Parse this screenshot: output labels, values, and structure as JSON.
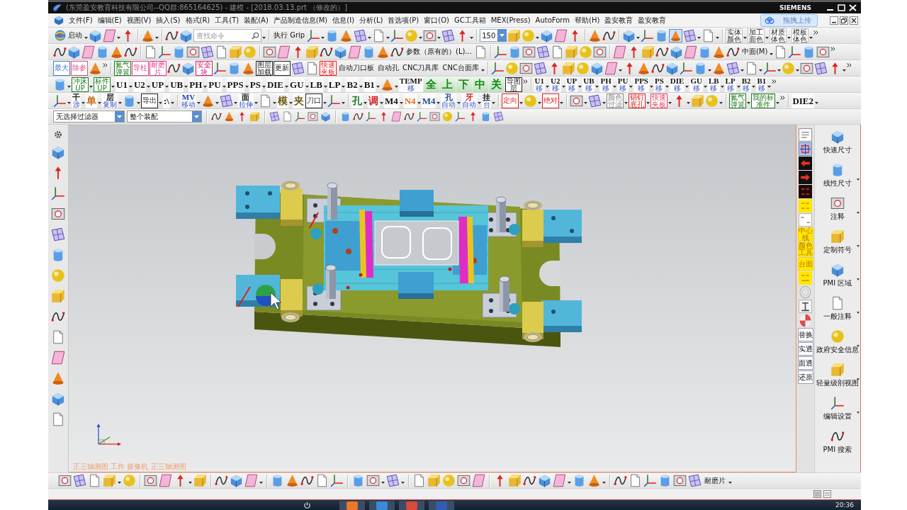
{
  "window": {
    "title": "(东莞盈安教育科技有限公司--QQ群:865164625) - 建模 - [2018.03.13.prt （修改的）]",
    "brand": "SIEMENS"
  },
  "menu": [
    "文件(F)",
    "编辑(E)",
    "视图(V)",
    "插入(S)",
    "格式(R)",
    "工具(T)",
    "装配(A)",
    "产品制造信息(M)",
    "信息(I)",
    "分析(L)",
    "首选项(P)",
    "窗口(O)",
    "GC工具箱",
    "MEX(Press)",
    "AutoForm",
    "帮助(H)",
    "盈安教育",
    "盈安教育"
  ],
  "upload_button": {
    "label": "拖拽上传"
  },
  "toolbars": [
    {
      "items": [
        {
          "kind": "start",
          "text": "启动",
          "menu": true
        },
        {
          "kind": "icon",
          "pressed": false
        },
        {
          "kind": "icon",
          "pressed": false,
          "menu": true
        },
        {
          "kind": "icon",
          "pressed": false
        },
        {
          "kind": "sep"
        },
        {
          "kind": "icon",
          "pressed": false,
          "menu": true
        },
        {
          "kind": "sep"
        },
        {
          "kind": "icon",
          "pressed": false
        },
        {
          "kind": "icon",
          "pressed": false
        },
        {
          "kind": "search",
          "placeholder": "查找命令",
          "menu": true
        },
        {
          "kind": "sep"
        },
        {
          "kind": "label",
          "text": "执行 Grip"
        },
        {
          "kind": "icon",
          "pressed": false,
          "menu": true
        },
        {
          "kind": "icon",
          "pressed": false
        },
        {
          "kind": "icon",
          "pressed": false
        },
        {
          "kind": "icon",
          "pressed": false,
          "menu": true
        },
        {
          "kind": "icon",
          "pressed": false,
          "menu": true
        },
        {
          "kind": "icon",
          "pressed": false
        },
        {
          "kind": "icon",
          "pressed": false,
          "menu": true
        },
        {
          "kind": "icon",
          "pressed": false,
          "menu": true
        },
        {
          "kind": "icon",
          "pressed": false
        },
        {
          "kind": "icon",
          "pressed": false,
          "menu": true
        },
        {
          "kind": "sep"
        },
        {
          "kind": "combo",
          "value": "150"
        },
        {
          "kind": "icon",
          "pressed": false
        },
        {
          "kind": "icon",
          "pressed": false,
          "menu": true
        },
        {
          "kind": "icon",
          "pressed": false
        },
        {
          "kind": "icon",
          "pressed": false
        },
        {
          "kind": "icon",
          "pressed": false
        },
        {
          "kind": "sep"
        },
        {
          "kind": "icon",
          "pressed": false
        },
        {
          "kind": "icon",
          "pressed": false
        },
        {
          "kind": "sep"
        },
        {
          "kind": "icon",
          "pressed": false,
          "menu": true
        },
        {
          "kind": "icon",
          "pressed": false
        },
        {
          "kind": "icon",
          "pressed": false
        },
        {
          "kind": "icon",
          "pressed": true
        },
        {
          "kind": "icon",
          "pressed": false,
          "menu": true
        },
        {
          "kind": "icon",
          "pressed": false,
          "menu": true
        },
        {
          "kind": "sep"
        },
        {
          "kind": "tile",
          "text": "实体颜色",
          "menu": true
        },
        {
          "kind": "tile",
          "text": "加工面色",
          "menu": true
        },
        {
          "kind": "tile",
          "text": "材质体色",
          "menu": true
        },
        {
          "kind": "tile",
          "text": "模板体色",
          "menu": true
        },
        {
          "kind": "more"
        }
      ]
    },
    {
      "items": [
        {
          "kind": "icon"
        },
        {
          "kind": "icon"
        },
        {
          "kind": "icon"
        },
        {
          "kind": "icon"
        },
        {
          "kind": "icon"
        },
        {
          "kind": "icon"
        },
        {
          "kind": "sep"
        },
        {
          "kind": "icon"
        },
        {
          "kind": "icon"
        },
        {
          "kind": "icon"
        },
        {
          "kind": "icon"
        },
        {
          "kind": "icon"
        },
        {
          "kind": "icon"
        },
        {
          "kind": "icon"
        },
        {
          "kind": "icon"
        },
        {
          "kind": "sep"
        },
        {
          "kind": "icon"
        },
        {
          "kind": "icon"
        },
        {
          "kind": "icon"
        },
        {
          "kind": "icon"
        },
        {
          "kind": "icon"
        },
        {
          "kind": "icon"
        },
        {
          "kind": "icon"
        },
        {
          "kind": "icon"
        },
        {
          "kind": "icon"
        },
        {
          "kind": "icon"
        },
        {
          "kind": "label",
          "text": "参数（原有的）(L)..."
        },
        {
          "kind": "icon"
        },
        {
          "kind": "sep"
        },
        {
          "kind": "icon"
        },
        {
          "kind": "icon"
        },
        {
          "kind": "icon"
        },
        {
          "kind": "icon"
        },
        {
          "kind": "icon"
        },
        {
          "kind": "icon"
        },
        {
          "kind": "icon"
        },
        {
          "kind": "icon"
        },
        {
          "kind": "sep"
        },
        {
          "kind": "icon"
        },
        {
          "kind": "icon"
        },
        {
          "kind": "icon"
        },
        {
          "kind": "icon"
        },
        {
          "kind": "icon"
        },
        {
          "kind": "icon"
        },
        {
          "kind": "icon"
        },
        {
          "kind": "icon"
        },
        {
          "kind": "icon"
        },
        {
          "kind": "label",
          "text": "中面(M)",
          "menu": true
        },
        {
          "kind": "icon"
        },
        {
          "kind": "icon"
        },
        {
          "kind": "icon"
        },
        {
          "kind": "icon"
        },
        {
          "kind": "more"
        }
      ]
    },
    {
      "items": [
        {
          "kind": "tile",
          "text": "最大",
          "color": "#3f7fd0"
        },
        {
          "kind": "tile",
          "text": "除参",
          "color": "#e0508a"
        },
        {
          "kind": "icon"
        },
        {
          "kind": "more"
        },
        {
          "kind": "sep"
        },
        {
          "kind": "tile",
          "text": "氮气弹簧",
          "color": "#1f7a1f"
        },
        {
          "kind": "tile",
          "text": "导柱",
          "color": "#e0408a"
        },
        {
          "kind": "tile",
          "text": "耐磨片",
          "color": "#e0408a"
        },
        {
          "kind": "icon"
        },
        {
          "kind": "icon"
        },
        {
          "kind": "tile",
          "text": "安全块",
          "color": "#d02070"
        },
        {
          "kind": "icon"
        },
        {
          "kind": "icon"
        },
        {
          "kind": "icon"
        },
        {
          "kind": "tile",
          "text": "图层加载",
          "color": "#222222"
        },
        {
          "kind": "tile",
          "text": "更新",
          "color": "#222222"
        },
        {
          "kind": "icon"
        },
        {
          "kind": "icon"
        },
        {
          "kind": "tile",
          "text": "快速夹板",
          "color": "#e02020"
        },
        {
          "kind": "label",
          "text": "自动刀口板"
        },
        {
          "kind": "label",
          "text": "自动孔"
        },
        {
          "kind": "label",
          "text": "CNC刀具库"
        },
        {
          "kind": "label",
          "text": "CNC台面库",
          "menu": true
        },
        {
          "kind": "sep"
        },
        {
          "kind": "icon"
        },
        {
          "kind": "icon"
        },
        {
          "kind": "icon"
        },
        {
          "kind": "icon"
        },
        {
          "kind": "icon"
        },
        {
          "kind": "icon"
        },
        {
          "kind": "icon"
        },
        {
          "kind": "icon"
        },
        {
          "kind": "icon",
          "menu": true
        },
        {
          "kind": "icon"
        },
        {
          "kind": "icon"
        },
        {
          "kind": "icon"
        },
        {
          "kind": "icon"
        },
        {
          "kind": "icon"
        },
        {
          "kind": "icon",
          "menu": true
        },
        {
          "kind": "icon"
        },
        {
          "kind": "icon",
          "menu": true
        },
        {
          "kind": "icon",
          "menu": true
        },
        {
          "kind": "icon",
          "menu": true
        },
        {
          "kind": "icon",
          "menu": true
        },
        {
          "kind": "icon"
        },
        {
          "kind": "icon"
        },
        {
          "kind": "icon",
          "menu": true
        },
        {
          "kind": "more"
        }
      ]
    },
    {
      "items": [
        {
          "kind": "icon",
          "menu": true
        },
        {
          "kind": "tile",
          "text": "冲床UP",
          "color": "#1f7a1f",
          "menu": true
        },
        {
          "kind": "tile",
          "text": "标件UP",
          "color": "#1f7a1f",
          "menu": true
        },
        {
          "kind": "code",
          "text": "U1",
          "menu": true
        },
        {
          "kind": "code",
          "text": "U2",
          "menu": true
        },
        {
          "kind": "code",
          "text": "UP",
          "menu": true
        },
        {
          "kind": "code",
          "text": "UB",
          "menu": true
        },
        {
          "kind": "code",
          "text": "PH",
          "menu": true
        },
        {
          "kind": "code",
          "text": "PU",
          "menu": true
        },
        {
          "kind": "code",
          "text": "PPS",
          "menu": true
        },
        {
          "kind": "code",
          "text": "PS",
          "menu": true
        },
        {
          "kind": "code",
          "text": "DIE",
          "menu": true
        },
        {
          "kind": "code",
          "text": "GU",
          "menu": true
        },
        {
          "kind": "code",
          "text": "LB",
          "menu": true
        },
        {
          "kind": "code",
          "text": "LP",
          "menu": true
        },
        {
          "kind": "code",
          "text": "B2",
          "menu": true
        },
        {
          "kind": "code",
          "text": "B1",
          "menu": true
        },
        {
          "kind": "icon",
          "menu": true
        },
        {
          "kind": "code",
          "text": "TEMP",
          "sub": "移"
        },
        {
          "kind": "hanzi",
          "text": "全"
        },
        {
          "kind": "hanzi",
          "text": "上"
        },
        {
          "kind": "hanzi",
          "text": "下"
        },
        {
          "kind": "hanzi",
          "text": "中"
        },
        {
          "kind": "hanzi",
          "text": "关"
        },
        {
          "kind": "tile",
          "text": "导图层",
          "color": "#222222"
        },
        {
          "kind": "more"
        },
        {
          "kind": "sep"
        },
        {
          "kind": "code",
          "text": "U1",
          "sub": "移",
          "menu": true
        },
        {
          "kind": "code",
          "text": "U2",
          "sub": "移",
          "menu": true
        },
        {
          "kind": "code",
          "text": "UP",
          "sub": "移",
          "menu": true
        },
        {
          "kind": "code",
          "text": "UB",
          "sub": "移",
          "menu": true
        },
        {
          "kind": "code",
          "text": "PH",
          "sub": "移",
          "menu": true
        },
        {
          "kind": "code",
          "text": "PU",
          "sub": "移",
          "menu": true
        },
        {
          "kind": "code",
          "text": "PPS",
          "sub": "移",
          "menu": true
        },
        {
          "kind": "code",
          "text": "PS",
          "sub": "移",
          "menu": true
        },
        {
          "kind": "code",
          "text": "DIE",
          "sub": "移",
          "menu": true
        },
        {
          "kind": "code",
          "text": "GU",
          "sub": "移",
          "menu": true
        },
        {
          "kind": "code",
          "text": "LB",
          "sub": "移",
          "menu": true
        },
        {
          "kind": "code",
          "text": "LP",
          "sub": "移",
          "menu": true
        },
        {
          "kind": "code",
          "text": "B2",
          "sub": "移",
          "menu": true
        },
        {
          "kind": "code",
          "text": "B1",
          "sub": "移",
          "menu": true
        },
        {
          "kind": "more"
        }
      ]
    },
    {
      "items": [
        {
          "kind": "icon",
          "menu": true
        },
        {
          "kind": "glyph",
          "text": "干",
          "sub": "涉",
          "color": "#222222",
          "menu": true
        },
        {
          "kind": "glyph",
          "text": "单",
          "color": "#c8701a",
          "menu": true
        },
        {
          "kind": "glyph",
          "text": "层",
          "sub": "复制",
          "color": "#222222",
          "menu": true
        },
        {
          "kind": "icon",
          "menu": true
        },
        {
          "kind": "tile",
          "text": "导出",
          "color": "#222222",
          "menu": true
        },
        {
          "kind": "code",
          "text": ":\\",
          "menu": true
        },
        {
          "kind": "sep"
        },
        {
          "kind": "code",
          "text": "MV",
          "sub": "移动",
          "color": "#1f3fb0",
          "menu": true
        },
        {
          "kind": "icon",
          "menu": true
        },
        {
          "kind": "icon",
          "menu": true
        },
        {
          "kind": "glyph",
          "text": "面",
          "sub": "拉伸",
          "color": "#222222",
          "menu": true
        },
        {
          "kind": "icon",
          "menu": true
        },
        {
          "kind": "glyph",
          "text": "模",
          "color": "#6a5a10",
          "menu": true
        },
        {
          "kind": "glyph",
          "text": "夹",
          "color": "#6a5a10"
        },
        {
          "kind": "tile",
          "text": "刀口",
          "color": "#222222",
          "menu": true
        },
        {
          "kind": "icon",
          "menu": true
        },
        {
          "kind": "sep"
        },
        {
          "kind": "glyph",
          "text": "孔",
          "color": "#1f7a1f",
          "menu": true
        },
        {
          "kind": "glyph",
          "text": "调",
          "color": "#d02020",
          "menu": true
        },
        {
          "kind": "code",
          "text": "M4",
          "menu": true
        },
        {
          "kind": "code",
          "text": "N4",
          "color": "#e07020",
          "menu": true
        },
        {
          "kind": "code",
          "text": "M4",
          "color": "#1f4f8f",
          "menu": true
        },
        {
          "kind": "glyph",
          "text": "孔",
          "sub": "自动",
          "color": "#1f3f8f",
          "menu": true
        },
        {
          "kind": "glyph",
          "text": "牙",
          "sub": "自动",
          "color": "#d02020",
          "menu": true
        },
        {
          "kind": "glyph",
          "text": "挂",
          "sub": "台",
          "color": "#222222",
          "menu": true
        },
        {
          "kind": "sep"
        },
        {
          "kind": "tile",
          "text": "定向",
          "color": "#e02020",
          "menu": true
        },
        {
          "kind": "icon",
          "menu": true
        },
        {
          "kind": "tile",
          "text": "绝对",
          "color": "#e02020",
          "menu": true
        },
        {
          "kind": "sep"
        },
        {
          "kind": "icon",
          "menu": true
        },
        {
          "kind": "icon",
          "menu": true
        },
        {
          "kind": "tile",
          "text": "颜色过滤",
          "color": "#888888",
          "menu": true
        },
        {
          "kind": "tile",
          "text": "销钉底孔",
          "color": "#d02020",
          "menu": true
        },
        {
          "kind": "tile",
          "text": "快速夹板",
          "color": "#e04060",
          "menu": true
        },
        {
          "kind": "icon",
          "menu": true
        },
        {
          "kind": "icon"
        },
        {
          "kind": "icon",
          "menu": true
        },
        {
          "kind": "sep"
        },
        {
          "kind": "tile",
          "text": "氮气弹簧",
          "color": "#1f7a1f",
          "menu": true
        },
        {
          "kind": "tile",
          "text": "我的标准件",
          "color": "#1f7a1f",
          "menu": true
        },
        {
          "kind": "more"
        },
        {
          "kind": "sep"
        },
        {
          "kind": "code",
          "text": "DIE2",
          "menu": true
        }
      ]
    }
  ],
  "filter_bar": {
    "filters": [
      "无选择过滤器",
      "整个装配"
    ]
  },
  "viewport": {
    "view_label": "正三轴测图 工作 摄像机 正三轴测图"
  },
  "side_strip": [
    {
      "kind": "icon",
      "pressed": false
    },
    {
      "kind": "icon",
      "pressed": true
    },
    {
      "kind": "icon",
      "pressed": false
    },
    {
      "kind": "icon",
      "pressed": false
    },
    {
      "kind": "icon",
      "pressed": false
    },
    {
      "kind": "icon",
      "pressed": false
    },
    {
      "kind": "icon",
      "pressed": false
    },
    {
      "kind": "note",
      "text": "中心线"
    },
    {
      "kind": "note",
      "text": "颜色工具"
    },
    {
      "kind": "note",
      "text": "台面"
    },
    {
      "kind": "icon",
      "pressed": false
    },
    {
      "kind": "icon",
      "pressed": false
    },
    {
      "kind": "icon",
      "pressed": false
    },
    {
      "kind": "icon",
      "pressed": false
    },
    {
      "kind": "tile",
      "text": "替换"
    },
    {
      "kind": "tile",
      "text": "实透"
    },
    {
      "kind": "tile",
      "text": "面透"
    },
    {
      "kind": "tile",
      "text": "还原"
    }
  ],
  "pmi_panel": [
    {
      "label": "快速尺寸",
      "menu": false
    },
    {
      "label": "线性尺寸",
      "menu": true
    },
    {
      "label": "注释",
      "menu": true
    },
    {
      "label": "定制符号",
      "menu": true
    },
    {
      "label": "PMI 区域",
      "menu": true
    },
    {
      "label": "一般注释",
      "menu": true
    },
    {
      "label": "政府安全信息",
      "menu": true
    },
    {
      "label": "轻量级剖视图",
      "menu": true
    },
    {
      "label": "编辑设置",
      "menu": true
    },
    {
      "label": "PMI 搜索",
      "menu": false
    }
  ],
  "bottom_toolbar": {
    "items": [
      {
        "kind": "icon"
      },
      {
        "kind": "icon"
      },
      {
        "kind": "icon"
      },
      {
        "kind": "icon",
        "menu": true
      },
      {
        "kind": "icon"
      },
      {
        "kind": "sep"
      },
      {
        "kind": "icon"
      },
      {
        "kind": "icon"
      },
      {
        "kind": "icon",
        "menu": true
      },
      {
        "kind": "icon"
      },
      {
        "kind": "sep"
      },
      {
        "kind": "icon"
      },
      {
        "kind": "icon"
      },
      {
        "kind": "icon",
        "menu": true
      },
      {
        "kind": "sep"
      },
      {
        "kind": "icon"
      },
      {
        "kind": "icon"
      },
      {
        "kind": "icon"
      },
      {
        "kind": "icon"
      },
      {
        "kind": "icon"
      },
      {
        "kind": "sep"
      },
      {
        "kind": "icon"
      },
      {
        "kind": "icon",
        "menu": true
      },
      {
        "kind": "icon",
        "menu": true
      },
      {
        "kind": "sep"
      },
      {
        "kind": "icon"
      },
      {
        "kind": "icon"
      },
      {
        "kind": "icon"
      },
      {
        "kind": "icon"
      },
      {
        "kind": "icon"
      },
      {
        "kind": "sep"
      },
      {
        "kind": "icon"
      },
      {
        "kind": "icon"
      },
      {
        "kind": "icon"
      },
      {
        "kind": "icon"
      },
      {
        "kind": "icon",
        "menu": true
      },
      {
        "kind": "icon"
      },
      {
        "kind": "icon",
        "menu": true
      },
      {
        "kind": "sep"
      },
      {
        "kind": "icon"
      },
      {
        "kind": "icon"
      },
      {
        "kind": "icon"
      },
      {
        "kind": "icon"
      },
      {
        "kind": "icon"
      },
      {
        "kind": "icon"
      },
      {
        "kind": "label",
        "text": "耐磨片",
        "menu": true
      }
    ]
  },
  "taskbar": {
    "clock": "20:36"
  }
}
